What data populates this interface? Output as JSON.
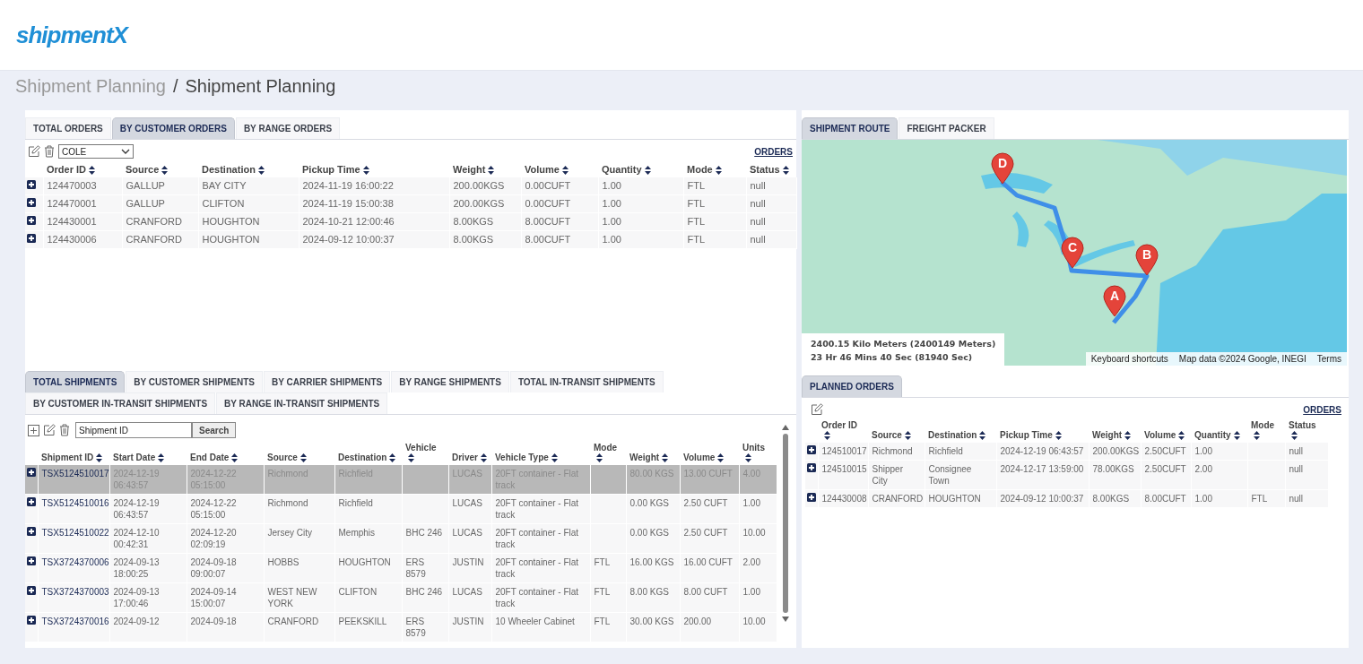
{
  "logo": "shipmentX",
  "breadcrumb": [
    {
      "label": "Shipment Planning",
      "selected": false
    },
    {
      "label": "Shipment Planning",
      "selected": true
    }
  ],
  "breadcrumb_separator": "/",
  "orders_panel": {
    "tabs": [
      {
        "label": "TOTAL ORDERS",
        "selected": false
      },
      {
        "label": "BY CUSTOMER ORDERS",
        "selected": true
      },
      {
        "label": "BY RANGE ORDERS",
        "selected": false
      }
    ],
    "customer_select": "COLE",
    "orders_link": "ORDERS",
    "columns": [
      "Order ID",
      "Source",
      "Destination",
      "Pickup Time",
      "Weight",
      "Volume",
      "Quantity",
      "Mode",
      "Status"
    ],
    "rows": [
      {
        "cells": [
          "124470003",
          "GALLUP",
          "BAY CITY",
          "2024-11-19 16:00:22",
          "200.00KGS",
          "0.00CUFT",
          "1.00",
          "FTL",
          "null"
        ]
      },
      {
        "cells": [
          "124470001",
          "GALLUP",
          "CLIFTON",
          "2024-11-19 15:00:38",
          "200.00KGS",
          "0.00CUFT",
          "1.00",
          "FTL",
          "null"
        ]
      },
      {
        "cells": [
          "124430001",
          "CRANFORD",
          "HOUGHTON",
          "2024-10-21 12:00:46",
          "8.00KGS",
          "8.00CUFT",
          "1.00",
          "FTL",
          "null"
        ]
      },
      {
        "cells": [
          "124430006",
          "CRANFORD",
          "HOUGHTON",
          "2024-09-12 10:00:37",
          "8.00KGS",
          "8.00CUFT",
          "1.00",
          "FTL",
          "null"
        ]
      }
    ]
  },
  "route_panel": {
    "tabs": [
      {
        "label": "SHIPMENT ROUTE",
        "selected": true
      },
      {
        "label": "FREIGHT PACKER",
        "selected": false
      }
    ],
    "markers": [
      {
        "label": "D"
      },
      {
        "label": "C"
      },
      {
        "label": "B"
      },
      {
        "label": "A"
      }
    ],
    "distance": "2400.15 Kilo Meters (2400149 Meters)",
    "duration": "23 Hr 46 Mins 40 Sec (81940 Sec)",
    "attribution": [
      "Keyboard shortcuts",
      "Map data ©2024 Google, INEGI",
      "Terms"
    ]
  },
  "shipments_panel": {
    "tabs": [
      {
        "label": "TOTAL SHIPMENTS",
        "selected": true
      },
      {
        "label": "BY CUSTOMER SHIPMENTS",
        "selected": false
      },
      {
        "label": "BY CARRIER SHIPMENTS",
        "selected": false
      },
      {
        "label": "BY RANGE SHIPMENTS",
        "selected": false
      },
      {
        "label": "TOTAL IN-TRANSIT SHIPMENTS",
        "selected": false
      },
      {
        "label": "BY CUSTOMER IN-TRANSIT SHIPMENTS",
        "selected": false
      },
      {
        "label": "BY RANGE IN-TRANSIT SHIPMENTS",
        "selected": false
      }
    ],
    "search": {
      "placeholder": "Shipment ID"
    },
    "search_button": "Search",
    "columns": [
      "Shipment ID",
      "Start Date",
      "End Date",
      "Source",
      "Destination",
      "Vehicle",
      "Driver",
      "Vehicle Type",
      "Mode",
      "Weight",
      "Volume",
      "Units"
    ],
    "rows": [
      {
        "selected": true,
        "cells": [
          "TSX5124510017",
          "2024-12-19 06:43:57",
          "2024-12-22 05:15:00",
          "Richmond",
          "Richfield",
          "",
          "LUCAS",
          "20FT container - Flat track",
          "",
          "80.00 KGS",
          "13.00 CUFT",
          "4.00"
        ]
      },
      {
        "selected": false,
        "cells": [
          "TSX5124510016",
          "2024-12-19 06:43:57",
          "2024-12-22 05:15:00",
          "Richmond",
          "Richfield",
          "",
          "LUCAS",
          "20FT container - Flat track",
          "",
          "0.00 KGS",
          "2.50 CUFT",
          "1.00"
        ]
      },
      {
        "selected": false,
        "cells": [
          "TSX5124510022",
          "2024-12-10 00:42:31",
          "2024-12-20 02:09:19",
          "Jersey City",
          "Memphis",
          "BHC 246",
          "LUCAS",
          "20FT container - Flat track",
          "",
          "0.00 KGS",
          "2.50 CUFT",
          "10.00"
        ]
      },
      {
        "selected": false,
        "cells": [
          "TSX3724370006",
          "2024-09-13 18:00:25",
          "2024-09-18 09:00:07",
          "HOBBS",
          "HOUGHTON",
          "ERS 8579",
          "JUSTIN",
          "20FT container - Flat track",
          "FTL",
          "16.00 KGS",
          "16.00 CUFT",
          "2.00"
        ]
      },
      {
        "selected": false,
        "cells": [
          "TSX3724370003",
          "2024-09-13 17:00:46",
          "2024-09-14 15:00:07",
          "WEST NEW YORK",
          "CLIFTON",
          "BHC 246",
          "LUCAS",
          "20FT container - Flat track",
          "FTL",
          "8.00 KGS",
          "8.00 CUFT",
          "1.00"
        ]
      },
      {
        "selected": false,
        "cells": [
          "TSX3724370016",
          "2024-09-12",
          "2024-09-18",
          "CRANFORD",
          "PEEKSKILL",
          "ERS 8579",
          "JUSTIN",
          "10 Wheeler Cabinet",
          "FTL",
          "30.00 KGS",
          "200.00",
          "10.00"
        ]
      }
    ]
  },
  "planned_panel": {
    "tabs": [
      {
        "label": "PLANNED ORDERS",
        "selected": true
      }
    ],
    "orders_link": "ORDERS",
    "columns": [
      "Order ID",
      "Source",
      "Destination",
      "Pickup Time",
      "Weight",
      "Volume",
      "Quantity",
      "Mode",
      "Status"
    ],
    "rows": [
      {
        "cells": [
          "124510017",
          "Richmond",
          "Richfield",
          "2024-12-19 06:43:57",
          "200.00KGS",
          "2.50CUFT",
          "1.00",
          "",
          "null"
        ]
      },
      {
        "cells": [
          "124510015",
          "Shipper City",
          "Consignee Town",
          "2024-12-17 13:59:00",
          "78.00KGS",
          "2.50CUFT",
          "2.00",
          "",
          "null"
        ]
      },
      {
        "cells": [
          "124430008",
          "CRANFORD",
          "HOUGHTON",
          "2024-09-12 10:00:37",
          "8.00KGS",
          "8.00CUFT",
          "1.00",
          "FTL",
          "null"
        ]
      }
    ]
  }
}
